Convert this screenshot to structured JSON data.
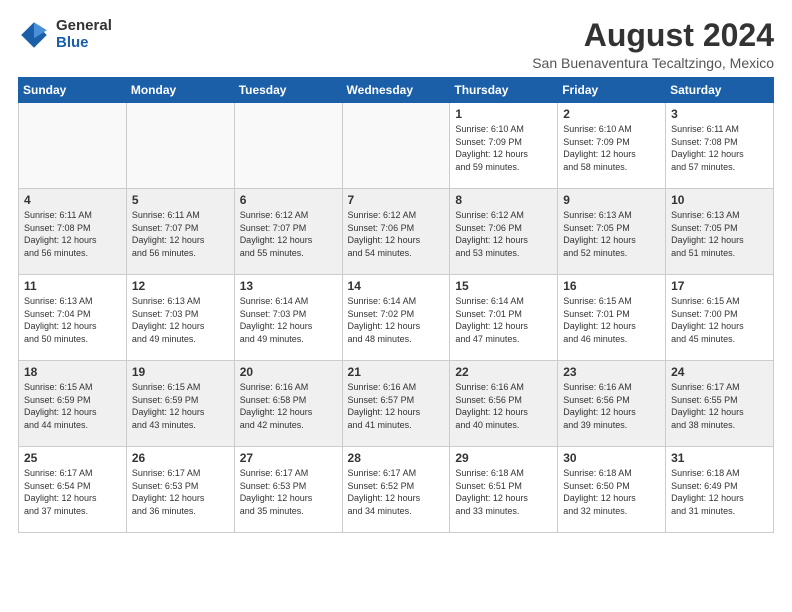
{
  "header": {
    "logo_general": "General",
    "logo_blue": "Blue",
    "month_year": "August 2024",
    "location": "San Buenaventura Tecaltzingo, Mexico"
  },
  "days_of_week": [
    "Sunday",
    "Monday",
    "Tuesday",
    "Wednesday",
    "Thursday",
    "Friday",
    "Saturday"
  ],
  "weeks": [
    [
      {
        "day": "",
        "info": ""
      },
      {
        "day": "",
        "info": ""
      },
      {
        "day": "",
        "info": ""
      },
      {
        "day": "",
        "info": ""
      },
      {
        "day": "1",
        "info": "Sunrise: 6:10 AM\nSunset: 7:09 PM\nDaylight: 12 hours\nand 59 minutes."
      },
      {
        "day": "2",
        "info": "Sunrise: 6:10 AM\nSunset: 7:09 PM\nDaylight: 12 hours\nand 58 minutes."
      },
      {
        "day": "3",
        "info": "Sunrise: 6:11 AM\nSunset: 7:08 PM\nDaylight: 12 hours\nand 57 minutes."
      }
    ],
    [
      {
        "day": "4",
        "info": "Sunrise: 6:11 AM\nSunset: 7:08 PM\nDaylight: 12 hours\nand 56 minutes."
      },
      {
        "day": "5",
        "info": "Sunrise: 6:11 AM\nSunset: 7:07 PM\nDaylight: 12 hours\nand 56 minutes."
      },
      {
        "day": "6",
        "info": "Sunrise: 6:12 AM\nSunset: 7:07 PM\nDaylight: 12 hours\nand 55 minutes."
      },
      {
        "day": "7",
        "info": "Sunrise: 6:12 AM\nSunset: 7:06 PM\nDaylight: 12 hours\nand 54 minutes."
      },
      {
        "day": "8",
        "info": "Sunrise: 6:12 AM\nSunset: 7:06 PM\nDaylight: 12 hours\nand 53 minutes."
      },
      {
        "day": "9",
        "info": "Sunrise: 6:13 AM\nSunset: 7:05 PM\nDaylight: 12 hours\nand 52 minutes."
      },
      {
        "day": "10",
        "info": "Sunrise: 6:13 AM\nSunset: 7:05 PM\nDaylight: 12 hours\nand 51 minutes."
      }
    ],
    [
      {
        "day": "11",
        "info": "Sunrise: 6:13 AM\nSunset: 7:04 PM\nDaylight: 12 hours\nand 50 minutes."
      },
      {
        "day": "12",
        "info": "Sunrise: 6:13 AM\nSunset: 7:03 PM\nDaylight: 12 hours\nand 49 minutes."
      },
      {
        "day": "13",
        "info": "Sunrise: 6:14 AM\nSunset: 7:03 PM\nDaylight: 12 hours\nand 49 minutes."
      },
      {
        "day": "14",
        "info": "Sunrise: 6:14 AM\nSunset: 7:02 PM\nDaylight: 12 hours\nand 48 minutes."
      },
      {
        "day": "15",
        "info": "Sunrise: 6:14 AM\nSunset: 7:01 PM\nDaylight: 12 hours\nand 47 minutes."
      },
      {
        "day": "16",
        "info": "Sunrise: 6:15 AM\nSunset: 7:01 PM\nDaylight: 12 hours\nand 46 minutes."
      },
      {
        "day": "17",
        "info": "Sunrise: 6:15 AM\nSunset: 7:00 PM\nDaylight: 12 hours\nand 45 minutes."
      }
    ],
    [
      {
        "day": "18",
        "info": "Sunrise: 6:15 AM\nSunset: 6:59 PM\nDaylight: 12 hours\nand 44 minutes."
      },
      {
        "day": "19",
        "info": "Sunrise: 6:15 AM\nSunset: 6:59 PM\nDaylight: 12 hours\nand 43 minutes."
      },
      {
        "day": "20",
        "info": "Sunrise: 6:16 AM\nSunset: 6:58 PM\nDaylight: 12 hours\nand 42 minutes."
      },
      {
        "day": "21",
        "info": "Sunrise: 6:16 AM\nSunset: 6:57 PM\nDaylight: 12 hours\nand 41 minutes."
      },
      {
        "day": "22",
        "info": "Sunrise: 6:16 AM\nSunset: 6:56 PM\nDaylight: 12 hours\nand 40 minutes."
      },
      {
        "day": "23",
        "info": "Sunrise: 6:16 AM\nSunset: 6:56 PM\nDaylight: 12 hours\nand 39 minutes."
      },
      {
        "day": "24",
        "info": "Sunrise: 6:17 AM\nSunset: 6:55 PM\nDaylight: 12 hours\nand 38 minutes."
      }
    ],
    [
      {
        "day": "25",
        "info": "Sunrise: 6:17 AM\nSunset: 6:54 PM\nDaylight: 12 hours\nand 37 minutes."
      },
      {
        "day": "26",
        "info": "Sunrise: 6:17 AM\nSunset: 6:53 PM\nDaylight: 12 hours\nand 36 minutes."
      },
      {
        "day": "27",
        "info": "Sunrise: 6:17 AM\nSunset: 6:53 PM\nDaylight: 12 hours\nand 35 minutes."
      },
      {
        "day": "28",
        "info": "Sunrise: 6:17 AM\nSunset: 6:52 PM\nDaylight: 12 hours\nand 34 minutes."
      },
      {
        "day": "29",
        "info": "Sunrise: 6:18 AM\nSunset: 6:51 PM\nDaylight: 12 hours\nand 33 minutes."
      },
      {
        "day": "30",
        "info": "Sunrise: 6:18 AM\nSunset: 6:50 PM\nDaylight: 12 hours\nand 32 minutes."
      },
      {
        "day": "31",
        "info": "Sunrise: 6:18 AM\nSunset: 6:49 PM\nDaylight: 12 hours\nand 31 minutes."
      }
    ]
  ]
}
